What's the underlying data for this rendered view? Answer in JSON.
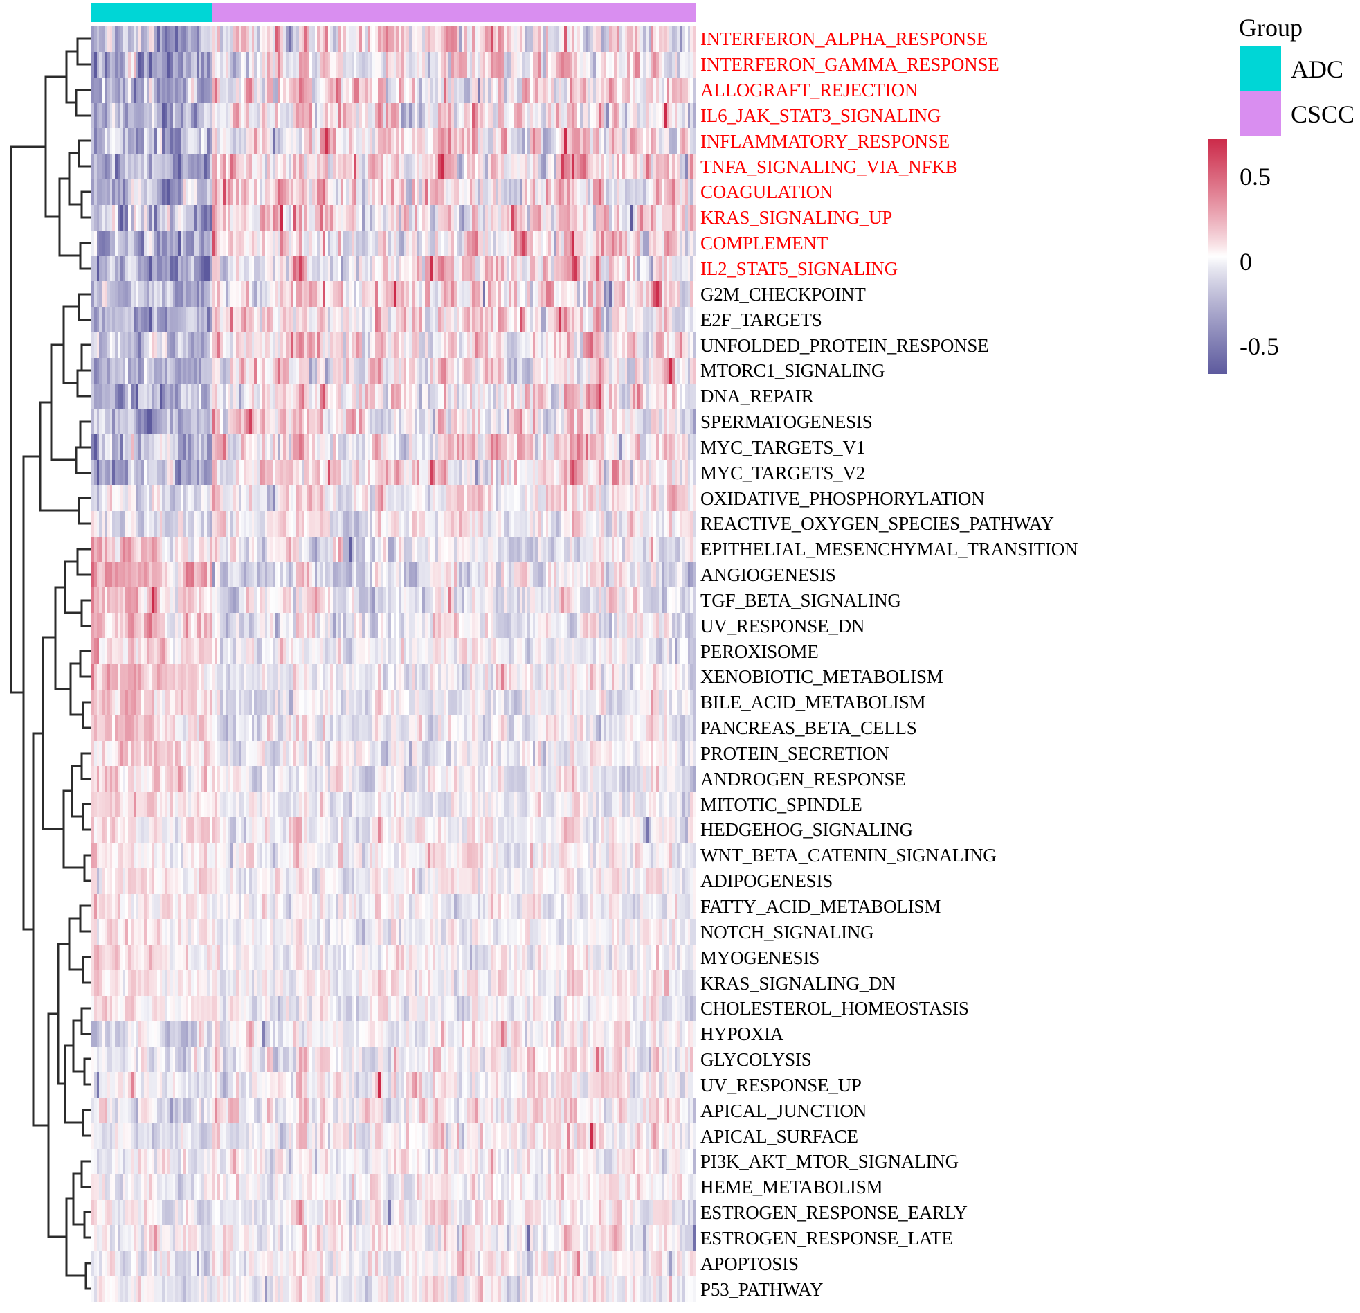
{
  "chart_data": {
    "type": "heatmap",
    "title": "",
    "xlabel": "",
    "ylabel": "",
    "value_label": "",
    "colorbar": {
      "ticks": [
        "0.5",
        "0",
        "-0.5"
      ],
      "min": -0.75,
      "max": 0.75,
      "low_color": "#5d5a9e",
      "mid_color": "#ffffff",
      "high_color": "#cc2a49"
    },
    "column_groups": [
      {
        "name": "ADC",
        "color": "#00d6d6",
        "count": 46
      },
      {
        "name": "CSCC",
        "color": "#d98ef0",
        "count": 184
      }
    ],
    "n_columns": 230,
    "row_labels": [
      "INTERFERON_ALPHA_RESPONSE",
      "INTERFERON_GAMMA_RESPONSE",
      "ALLOGRAFT_REJECTION",
      "IL6_JAK_STAT3_SIGNALING",
      "INFLAMMATORY_RESPONSE",
      "TNFA_SIGNALING_VIA_NFKB",
      "COAGULATION",
      "KRAS_SIGNALING_UP",
      "COMPLEMENT",
      "IL2_STAT5_SIGNALING",
      "G2M_CHECKPOINT",
      "E2F_TARGETS",
      "UNFOLDED_PROTEIN_RESPONSE",
      "MTORC1_SIGNALING",
      "DNA_REPAIR",
      "SPERMATOGENESIS",
      "MYC_TARGETS_V1",
      "MYC_TARGETS_V2",
      "OXIDATIVE_PHOSPHORYLATION",
      "REACTIVE_OXYGEN_SPECIES_PATHWAY",
      "EPITHELIAL_MESENCHYMAL_TRANSITION",
      "ANGIOGENESIS",
      "TGF_BETA_SIGNALING",
      "UV_RESPONSE_DN",
      "PEROXISOME",
      "XENOBIOTIC_METABOLISM",
      "BILE_ACID_METABOLISM",
      "PANCREAS_BETA_CELLS",
      "PROTEIN_SECRETION",
      "ANDROGEN_RESPONSE",
      "MITOTIC_SPINDLE",
      "HEDGEHOG_SIGNALING",
      "WNT_BETA_CATENIN_SIGNALING",
      "ADIPOGENESIS",
      "FATTY_ACID_METABOLISM",
      "NOTCH_SIGNALING",
      "MYOGENESIS",
      "KRAS_SIGNALING_DN",
      "CHOLESTEROL_HOMEOSTASIS",
      "HYPOXIA",
      "GLYCOLYSIS",
      "UV_RESPONSE_UP",
      "APICAL_JUNCTION",
      "APICAL_SURFACE",
      "PI3K_AKT_MTOR_SIGNALING",
      "HEME_METABOLISM",
      "ESTROGEN_RESPONSE_EARLY",
      "ESTROGEN_RESPONSE_LATE",
      "APOPTOSIS",
      "P53_PATHWAY"
    ],
    "highlighted_rows": [
      "INTERFERON_ALPHA_RESPONSE",
      "INTERFERON_GAMMA_RESPONSE",
      "ALLOGRAFT_REJECTION",
      "IL6_JAK_STAT3_SIGNALING",
      "INFLAMMATORY_RESPONSE",
      "TNFA_SIGNALING_VIA_NFKB",
      "COAGULATION",
      "KRAS_SIGNALING_UP",
      "COMPLEMENT",
      "IL2_STAT5_SIGNALING"
    ],
    "row_dendrogram": true,
    "col_dendrogram": false
  },
  "legend": {
    "group_title": "Group",
    "entries": [
      {
        "label": "ADC",
        "color": "#00d6d6"
      },
      {
        "label": "CSCC",
        "color": "#d98ef0"
      }
    ],
    "scale_ticks": [
      {
        "label": "0.5",
        "pos": 0.165
      },
      {
        "label": "0",
        "pos": 0.525
      },
      {
        "label": "-0.5",
        "pos": 0.885
      }
    ]
  },
  "top_annotation_label": "Group"
}
